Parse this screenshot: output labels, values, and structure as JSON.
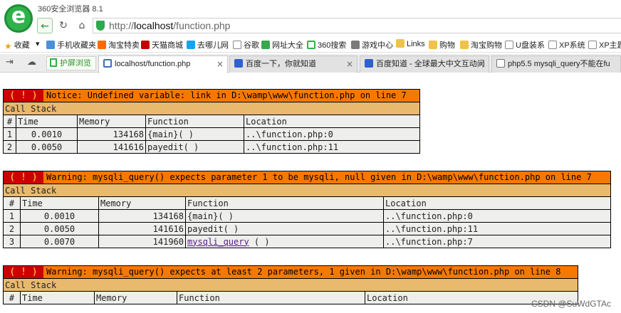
{
  "app": {
    "title": "360安全浏览器 8.1"
  },
  "nav": {
    "back": "←",
    "refresh": "↻",
    "home": "⌂",
    "url_scheme": "http://",
    "url_host": "localhost",
    "url_path": "/function.php"
  },
  "bookmarks": [
    {
      "label": "收藏",
      "icon": "star-icon"
    },
    {
      "label": "▾",
      "icon": ""
    },
    {
      "label": "手机收藏夹",
      "icon": "phone-icon"
    },
    {
      "label": "淘宝特卖",
      "icon": "taobao-icon"
    },
    {
      "label": "天猫商城",
      "icon": "tmall-icon"
    },
    {
      "label": "去哪儿网",
      "icon": "qunar-icon"
    },
    {
      "label": "谷歌",
      "icon": "doc-icon"
    },
    {
      "label": "网址大全",
      "icon": "globe-icon"
    },
    {
      "label": "360搜索",
      "icon": "360-icon"
    },
    {
      "label": "游戏中心",
      "icon": "game-icon"
    },
    {
      "label": "Links",
      "icon": "folder-icon"
    },
    {
      "label": "购物",
      "icon": "folder-icon"
    },
    {
      "label": "淘宝购物",
      "icon": "folder-icon"
    },
    {
      "label": "U盘装系",
      "icon": "doc-icon"
    },
    {
      "label": "XP系统",
      "icon": "doc-icon"
    },
    {
      "label": "XP主题",
      "icon": "doc-icon"
    }
  ],
  "tabbar": {
    "split_label": "护屏浏览",
    "tabs": [
      {
        "label": "localhost/function.php",
        "icon": "php-icon",
        "active": true
      },
      {
        "label": "百度一下，你就知道",
        "icon": "baidu-icon",
        "active": false
      },
      {
        "label": "百度知道 - 全球最大中文互动问",
        "icon": "baidu-icon",
        "active": false
      },
      {
        "label": "php5.5 mysqli_query不能在fu",
        "icon": "page-icon",
        "active": false
      }
    ],
    "close_glyph": "×"
  },
  "errors": [
    {
      "badge": "( ! )",
      "message": "Notice: Undefined variable: link in D:\\wamp\\www\\function.php on line 7",
      "stack_title": "Call Stack",
      "headers": [
        "#",
        "Time",
        "Memory",
        "Function",
        "Location"
      ],
      "rows": [
        {
          "n": "1",
          "time": "0.0010",
          "memory": "134168",
          "func": "{main}( )",
          "loc": "..\\function.php:0"
        },
        {
          "n": "2",
          "time": "0.0050",
          "memory": "141616",
          "func": "payedit( )",
          "loc": "..\\function.php:11"
        }
      ]
    },
    {
      "badge": "( ! )",
      "message": "Warning: mysqli_query() expects parameter 1 to be mysqli, null given in D:\\wamp\\www\\function.php on line 7",
      "stack_title": "Call Stack",
      "headers": [
        "#",
        "Time",
        "Memory",
        "Function",
        "Location"
      ],
      "rows": [
        {
          "n": "1",
          "time": "0.0010",
          "memory": "134168",
          "func": "{main}( )",
          "loc": "..\\function.php:0"
        },
        {
          "n": "2",
          "time": "0.0050",
          "memory": "141616",
          "func": "payedit( )",
          "loc": "..\\function.php:11"
        },
        {
          "n": "3",
          "time": "0.0070",
          "memory": "141960",
          "func_link": "mysqli_query",
          "func": " ( )",
          "loc": "..\\function.php:7"
        }
      ]
    },
    {
      "badge": "( ! )",
      "message": "Warning: mysqli_query() expects at least 2 parameters, 1 given in D:\\wamp\\www\\function.php on line 8",
      "stack_title": "Call Stack",
      "headers": [
        "#",
        "Time",
        "Memory",
        "Function",
        "Location"
      ],
      "rows": []
    }
  ],
  "watermark": "CSDN @SuWdGTAc"
}
